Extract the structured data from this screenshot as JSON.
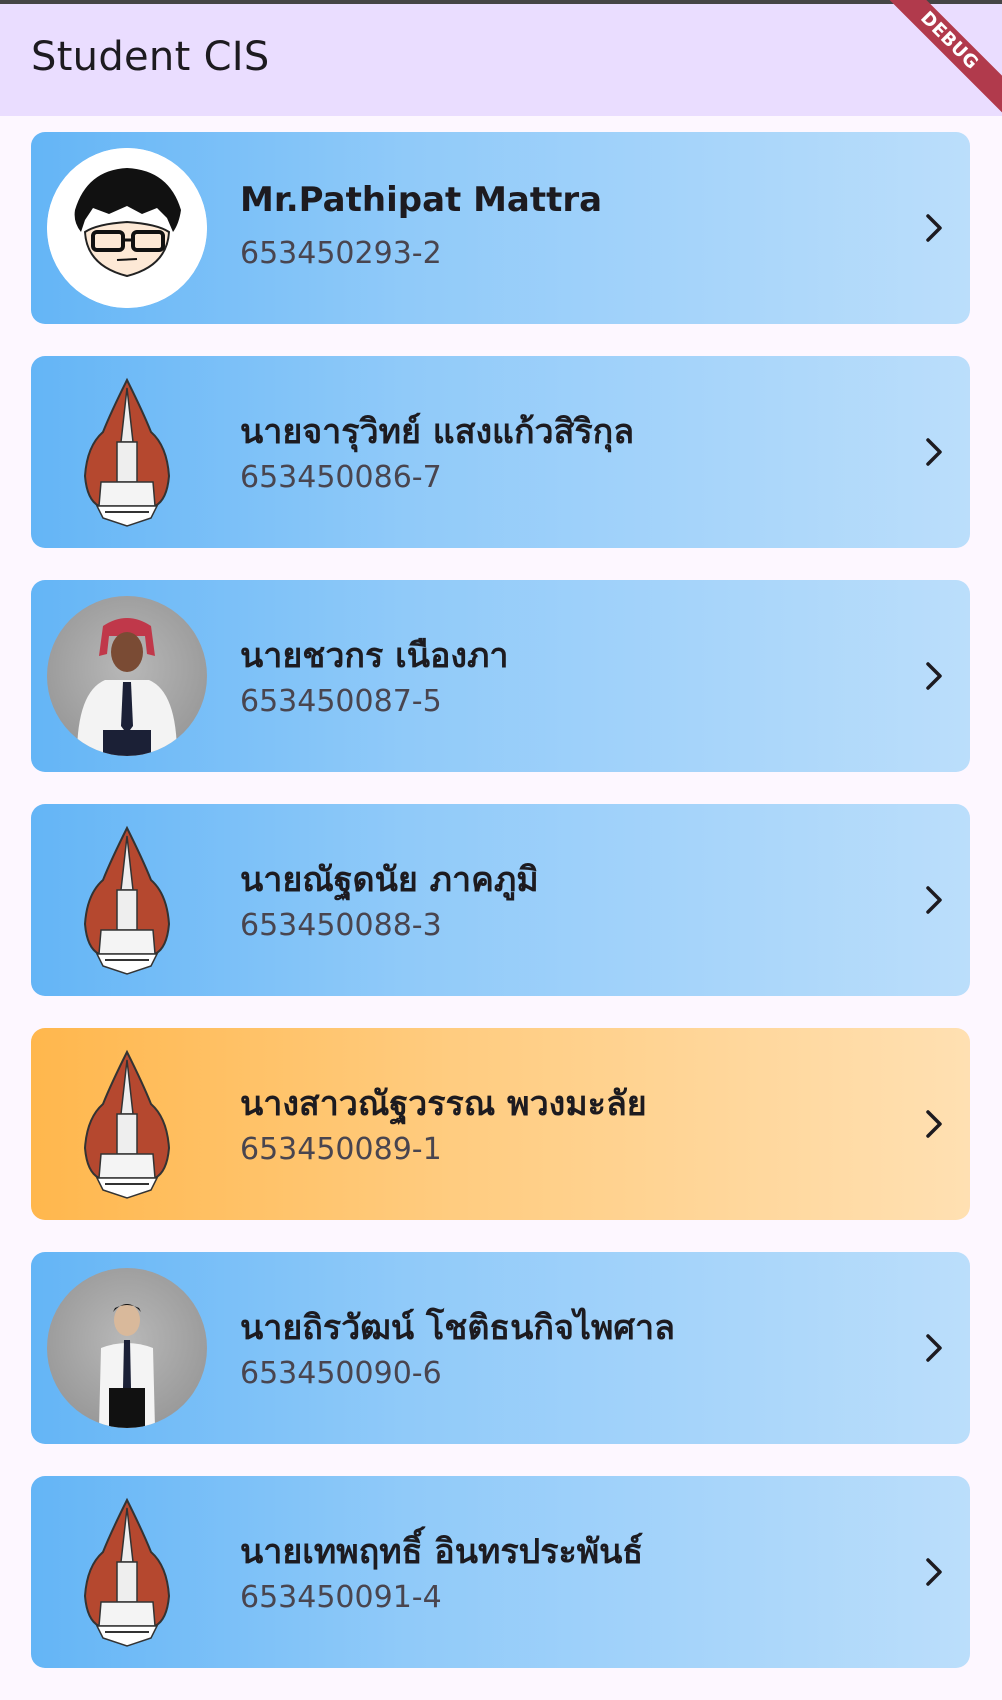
{
  "app_bar": {
    "title": "Student CIS"
  },
  "debug_banner": {
    "label": "DEBUG"
  },
  "colors": {
    "app_bar_bg": "#eaddff",
    "card_blue_start": "#64b5f6",
    "card_blue_end": "#bbdefb",
    "card_orange_start": "#ffb74d",
    "card_orange_end": "#ffe0b2"
  },
  "students": [
    {
      "name": "Mr.Pathipat Mattra",
      "id": "653450293-2",
      "avatar": "cartoon-avatar",
      "highlight": false
    },
    {
      "name": "นายจารุวิทย์ แสงแก้วสิริกุล",
      "id": "653450086-7",
      "avatar": "university-logo",
      "highlight": false
    },
    {
      "name": "นายชวกร เนืองภา",
      "id": "653450087-5",
      "avatar": "student-photo",
      "highlight": false
    },
    {
      "name": "นายณัฐดนัย ภาคภูมิ",
      "id": "653450088-3",
      "avatar": "university-logo",
      "highlight": false
    },
    {
      "name": "นางสาวณัฐวรรณ พวงมะลัย",
      "id": "653450089-1",
      "avatar": "university-logo",
      "highlight": true
    },
    {
      "name": "นายถิรวัฒน์ โชติธนกิจไพศาล",
      "id": "653450090-6",
      "avatar": "student-photo",
      "highlight": false
    },
    {
      "name": "นายเทพฤทธิ์ อินทรประพันธ์",
      "id": "653450091-4",
      "avatar": "university-logo",
      "highlight": false
    }
  ]
}
